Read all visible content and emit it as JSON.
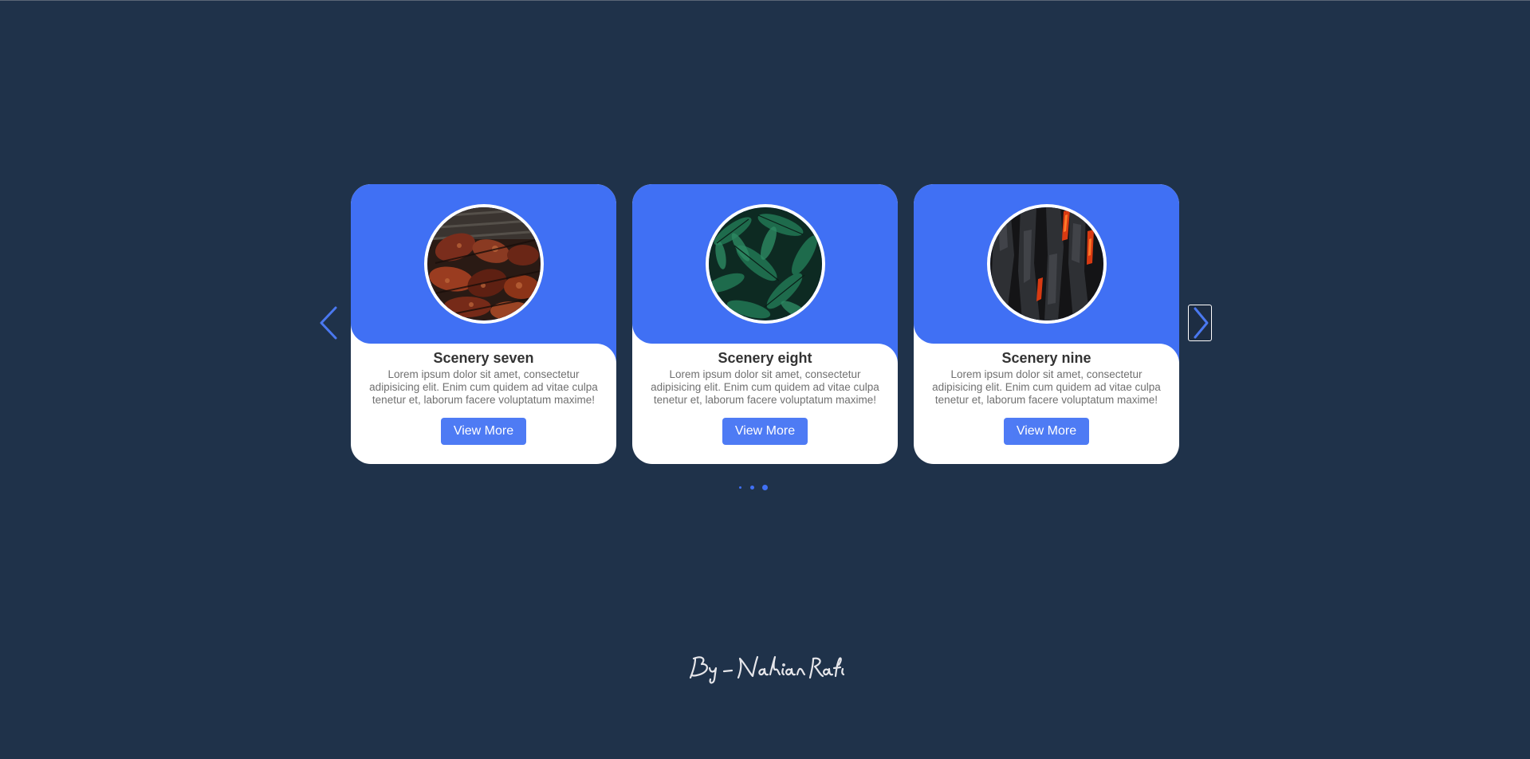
{
  "colors": {
    "background": "#1f324a",
    "accent": "#4070f4",
    "card": "#ffffff"
  },
  "slider": {
    "prev_icon": "chevron-left-icon",
    "next_icon": "chevron-right-icon",
    "cards": [
      {
        "title": "Scenery seven",
        "description": "Lorem ipsum dolor sit amet, consectetur adipisicing elit. Enim cum quidem ad vitae culpa tenetur et, laborum facere voluptatum maxime!",
        "button_label": "View More",
        "image": "grilled-meat-photo"
      },
      {
        "title": "Scenery eight",
        "description": "Lorem ipsum dolor sit amet, consectetur adipisicing elit. Enim cum quidem ad vitae culpa tenetur et, laborum facere voluptatum maxime!",
        "button_label": "View More",
        "image": "green-leaves-photo"
      },
      {
        "title": "Scenery nine",
        "description": "Lorem ipsum dolor sit amet, consectetur adipisicing elit. Enim cum quidem ad vitae culpa tenetur et, laborum facere voluptatum maxime!",
        "button_label": "View More",
        "image": "burning-bark-photo"
      }
    ],
    "pagination": {
      "total": 3,
      "active_index": 2
    }
  },
  "footer": {
    "signature": "By - Nahian Rafi"
  }
}
